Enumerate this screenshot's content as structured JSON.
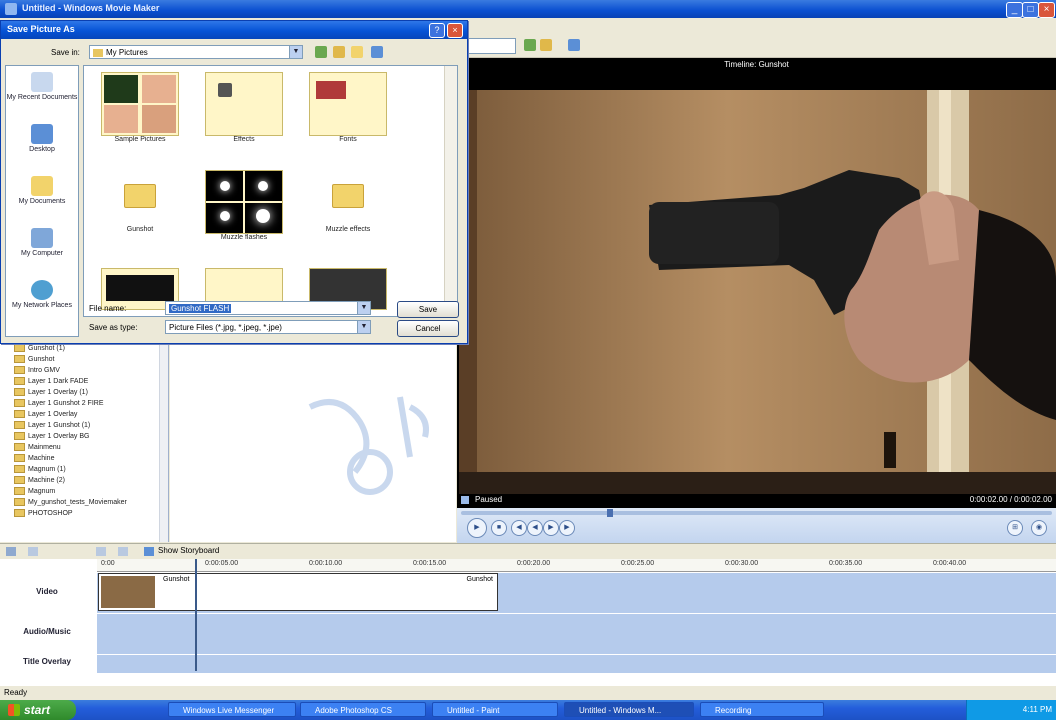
{
  "window": {
    "title": "Untitled - Windows Movie Maker"
  },
  "dialog": {
    "title": "Save Picture As",
    "save_in_label": "Save in:",
    "save_in_value": "My Pictures",
    "places": [
      "My Recent Documents",
      "Desktop",
      "My Documents",
      "My Computer",
      "My Network Places"
    ],
    "items": [
      {
        "label": "Sample Pictures",
        "kind": "thumb-faces"
      },
      {
        "label": "Effects",
        "kind": "thumb-yellow"
      },
      {
        "label": "Fonts",
        "kind": "thumb-red"
      },
      {
        "label": "Gunshot",
        "kind": "folder"
      },
      {
        "label": "Muzzle flashes",
        "kind": "thumb-flash"
      },
      {
        "label": "Muzzle effects",
        "kind": "folder"
      }
    ],
    "file_name_label": "File name:",
    "file_name_value": "Gunshot FLASH",
    "save_type_label": "Save as type:",
    "save_type_value": "Picture Files (*.jpg, *.jpeg, *.jpe)",
    "save_button": "Save",
    "cancel_button": "Cancel"
  },
  "collections": {
    "items": [
      "Gunshot (1)",
      "Gunshot",
      "Intro GMV",
      "Layer 1 Dark FADE",
      "Layer 1 Overlay (1)",
      "Layer 1 Gunshot 2 FIRE",
      "Layer 1 Overlay",
      "Layer 1 Gunshot (1)",
      "Layer 1 Overlay BG",
      "Mainmenu",
      "Machine",
      "Magnum (1)",
      "Machine (2)",
      "Magnum",
      "My_gunshot_tests_Moviemaker",
      "PHOTOSHOP"
    ]
  },
  "monitor": {
    "title": "Timeline: Gunshot",
    "status_left": "Paused",
    "time": "0:00:02.00 / 0:00:02.00"
  },
  "timeline": {
    "toolbar_label": "Show Storyboard",
    "ruler": [
      "0:00",
      "0:00:05.00",
      "0:00:10.00",
      "0:00:15.00",
      "0:00:20.00",
      "0:00:25.00",
      "0:00:30.00",
      "0:00:35.00",
      "0:00:40.00"
    ],
    "tracks": [
      "Video",
      "Audio/Music",
      "Title Overlay"
    ],
    "clip_left": "Gunshot",
    "clip_right": "Gunshot"
  },
  "status": {
    "text": "Ready"
  },
  "taskbar": {
    "start": "start",
    "tasks": [
      "Windows Live Messenger",
      "Adobe Photoshop CS",
      "Untitled - Paint",
      "Untitled - Windows M...",
      "Recording"
    ],
    "clock": "4:11 PM"
  }
}
